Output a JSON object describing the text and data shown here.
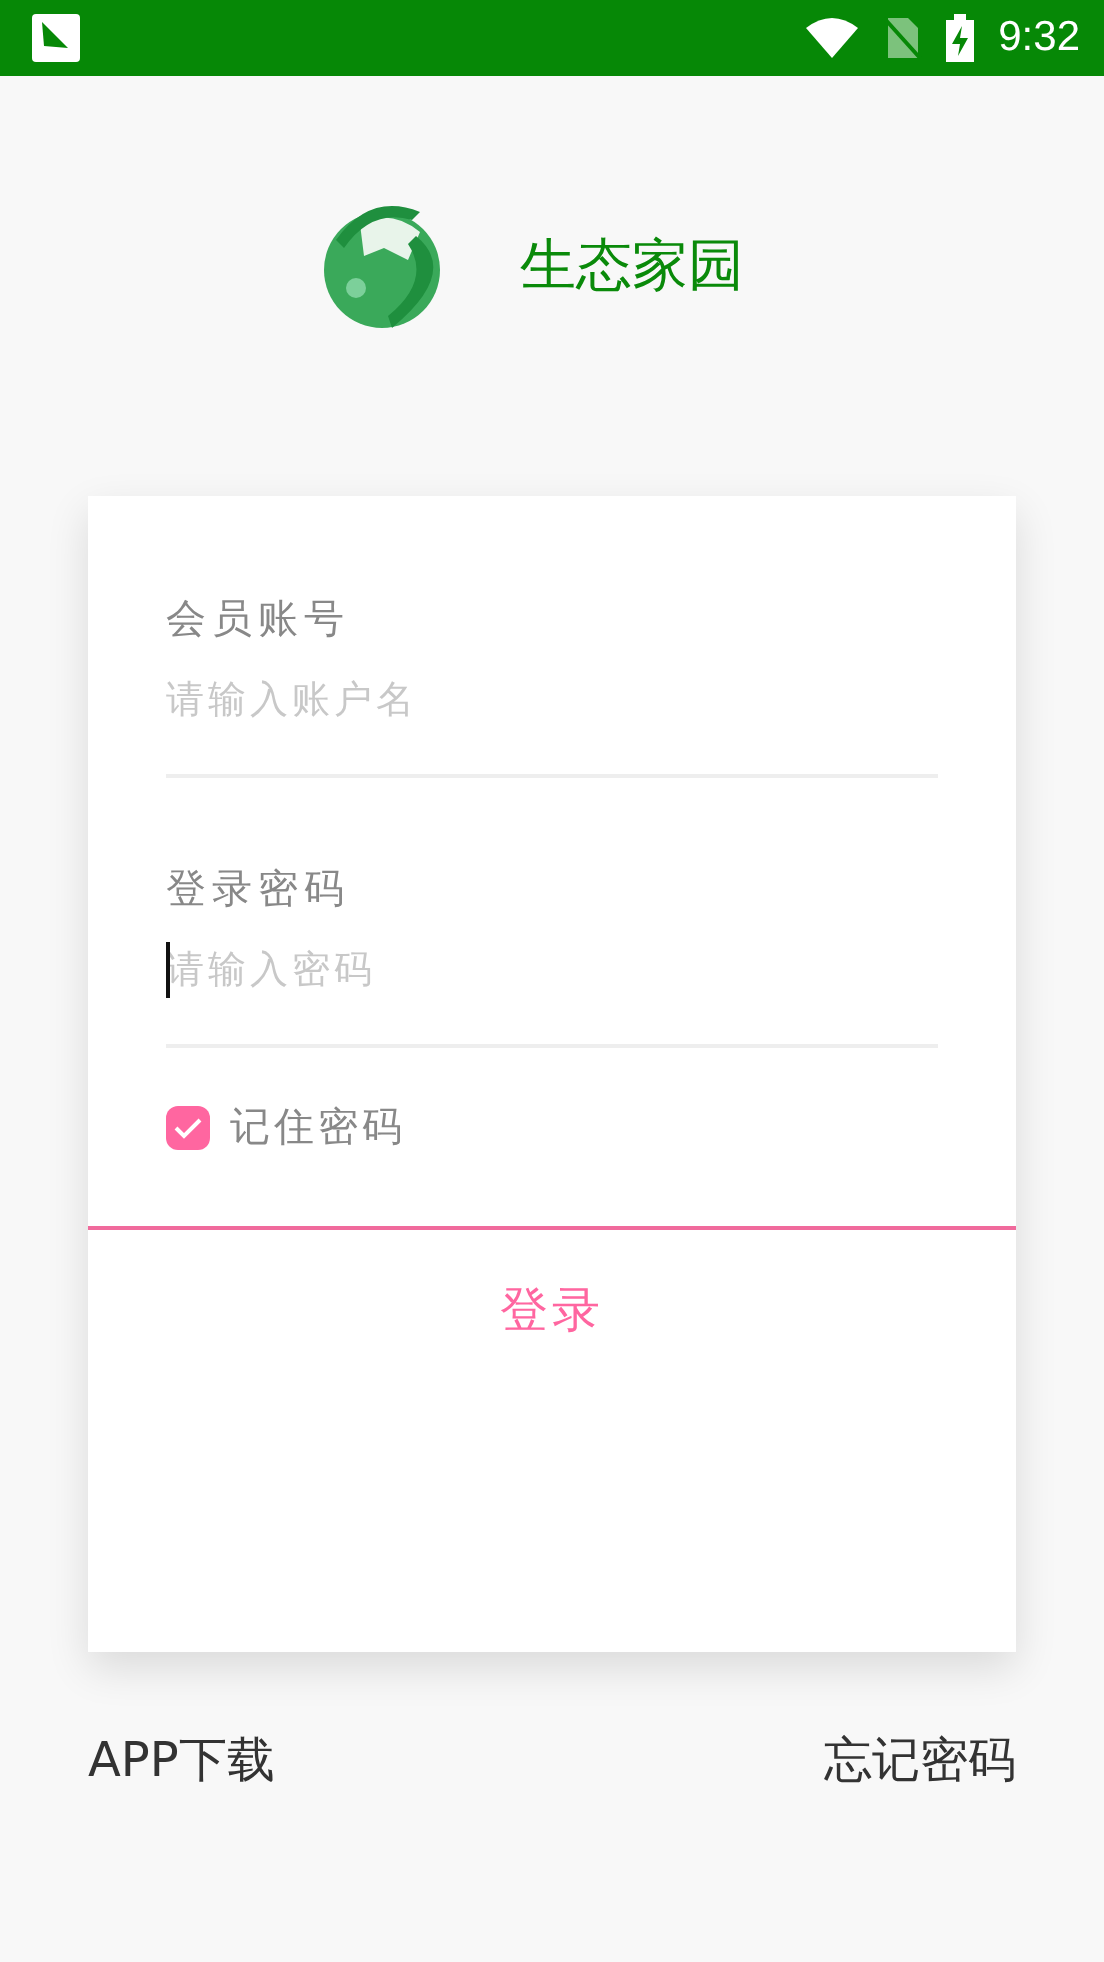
{
  "status_bar": {
    "time": "9:32"
  },
  "header": {
    "title": "生态家园"
  },
  "form": {
    "fields": [
      {
        "label": "会员账号",
        "placeholder": "请输入账户名",
        "focused": false
      },
      {
        "label": "登录密码",
        "placeholder": "请输入密码",
        "focused": true
      }
    ],
    "remember": {
      "label": "记住密码",
      "checked": true
    },
    "submit": "登录"
  },
  "footer": {
    "links": [
      "APP下载",
      "忘记密码"
    ]
  }
}
